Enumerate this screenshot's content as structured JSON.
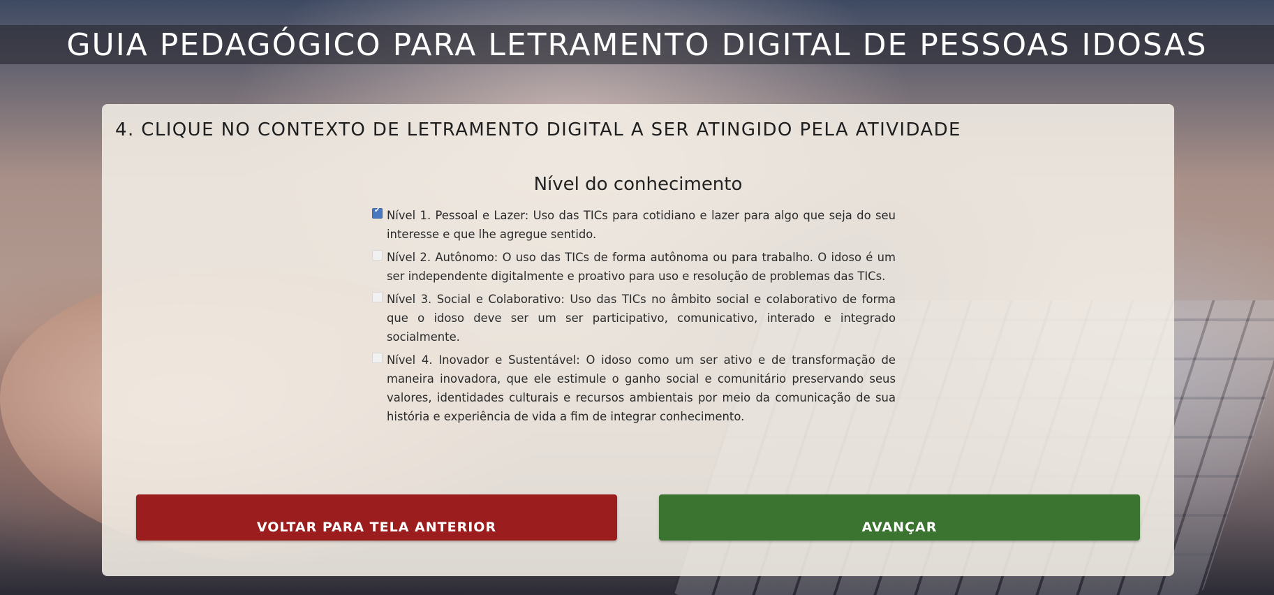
{
  "header": {
    "title": "GUIA PEDAGÓGICO PARA LETRAMENTO DIGITAL DE PESSOAS IDOSAS"
  },
  "panel": {
    "heading": "4. CLIQUE NO CONTEXTO DE LETRAMENTO DIGITAL A SER ATINGIDO PELA ATIVIDADE",
    "section_title": "Nível do conhecimento",
    "options": [
      {
        "text": "Nível 1. Pessoal e Lazer: Uso das TICs para cotidiano e lazer para algo que seja do seu interesse e que lhe agregue sentido.",
        "checked": true
      },
      {
        "text": "Nível 2. Autônomo: O uso das TICs de forma autônoma ou para trabalho. O idoso é um ser independente digitalmente e proativo para uso e resolução de problemas das TICs.",
        "checked": false
      },
      {
        "text": "Nível 3. Social e Colaborativo: Uso das TICs no âmbito social e colaborativo de forma que o idoso deve ser um ser participativo, comunicativo, interado e integrado socialmente.",
        "checked": false
      },
      {
        "text": "Nível 4. Inovador e Sustentável: O idoso como um ser ativo e de transformação de maneira inovadora, que ele estimule o ganho social e comunitário preservando seus valores, identidades culturais e recursos ambientais por meio da comunicação de sua história e experiência de vida a fim de integrar conhecimento.",
        "checked": false
      }
    ]
  },
  "buttons": {
    "back_label": "VOLTAR PARA TELA ANTERIOR",
    "next_label": "AVANÇAR"
  },
  "colors": {
    "back_button": "#9b1d1d",
    "next_button": "#3a7430",
    "checkbox_checked": "#4a78bf"
  }
}
